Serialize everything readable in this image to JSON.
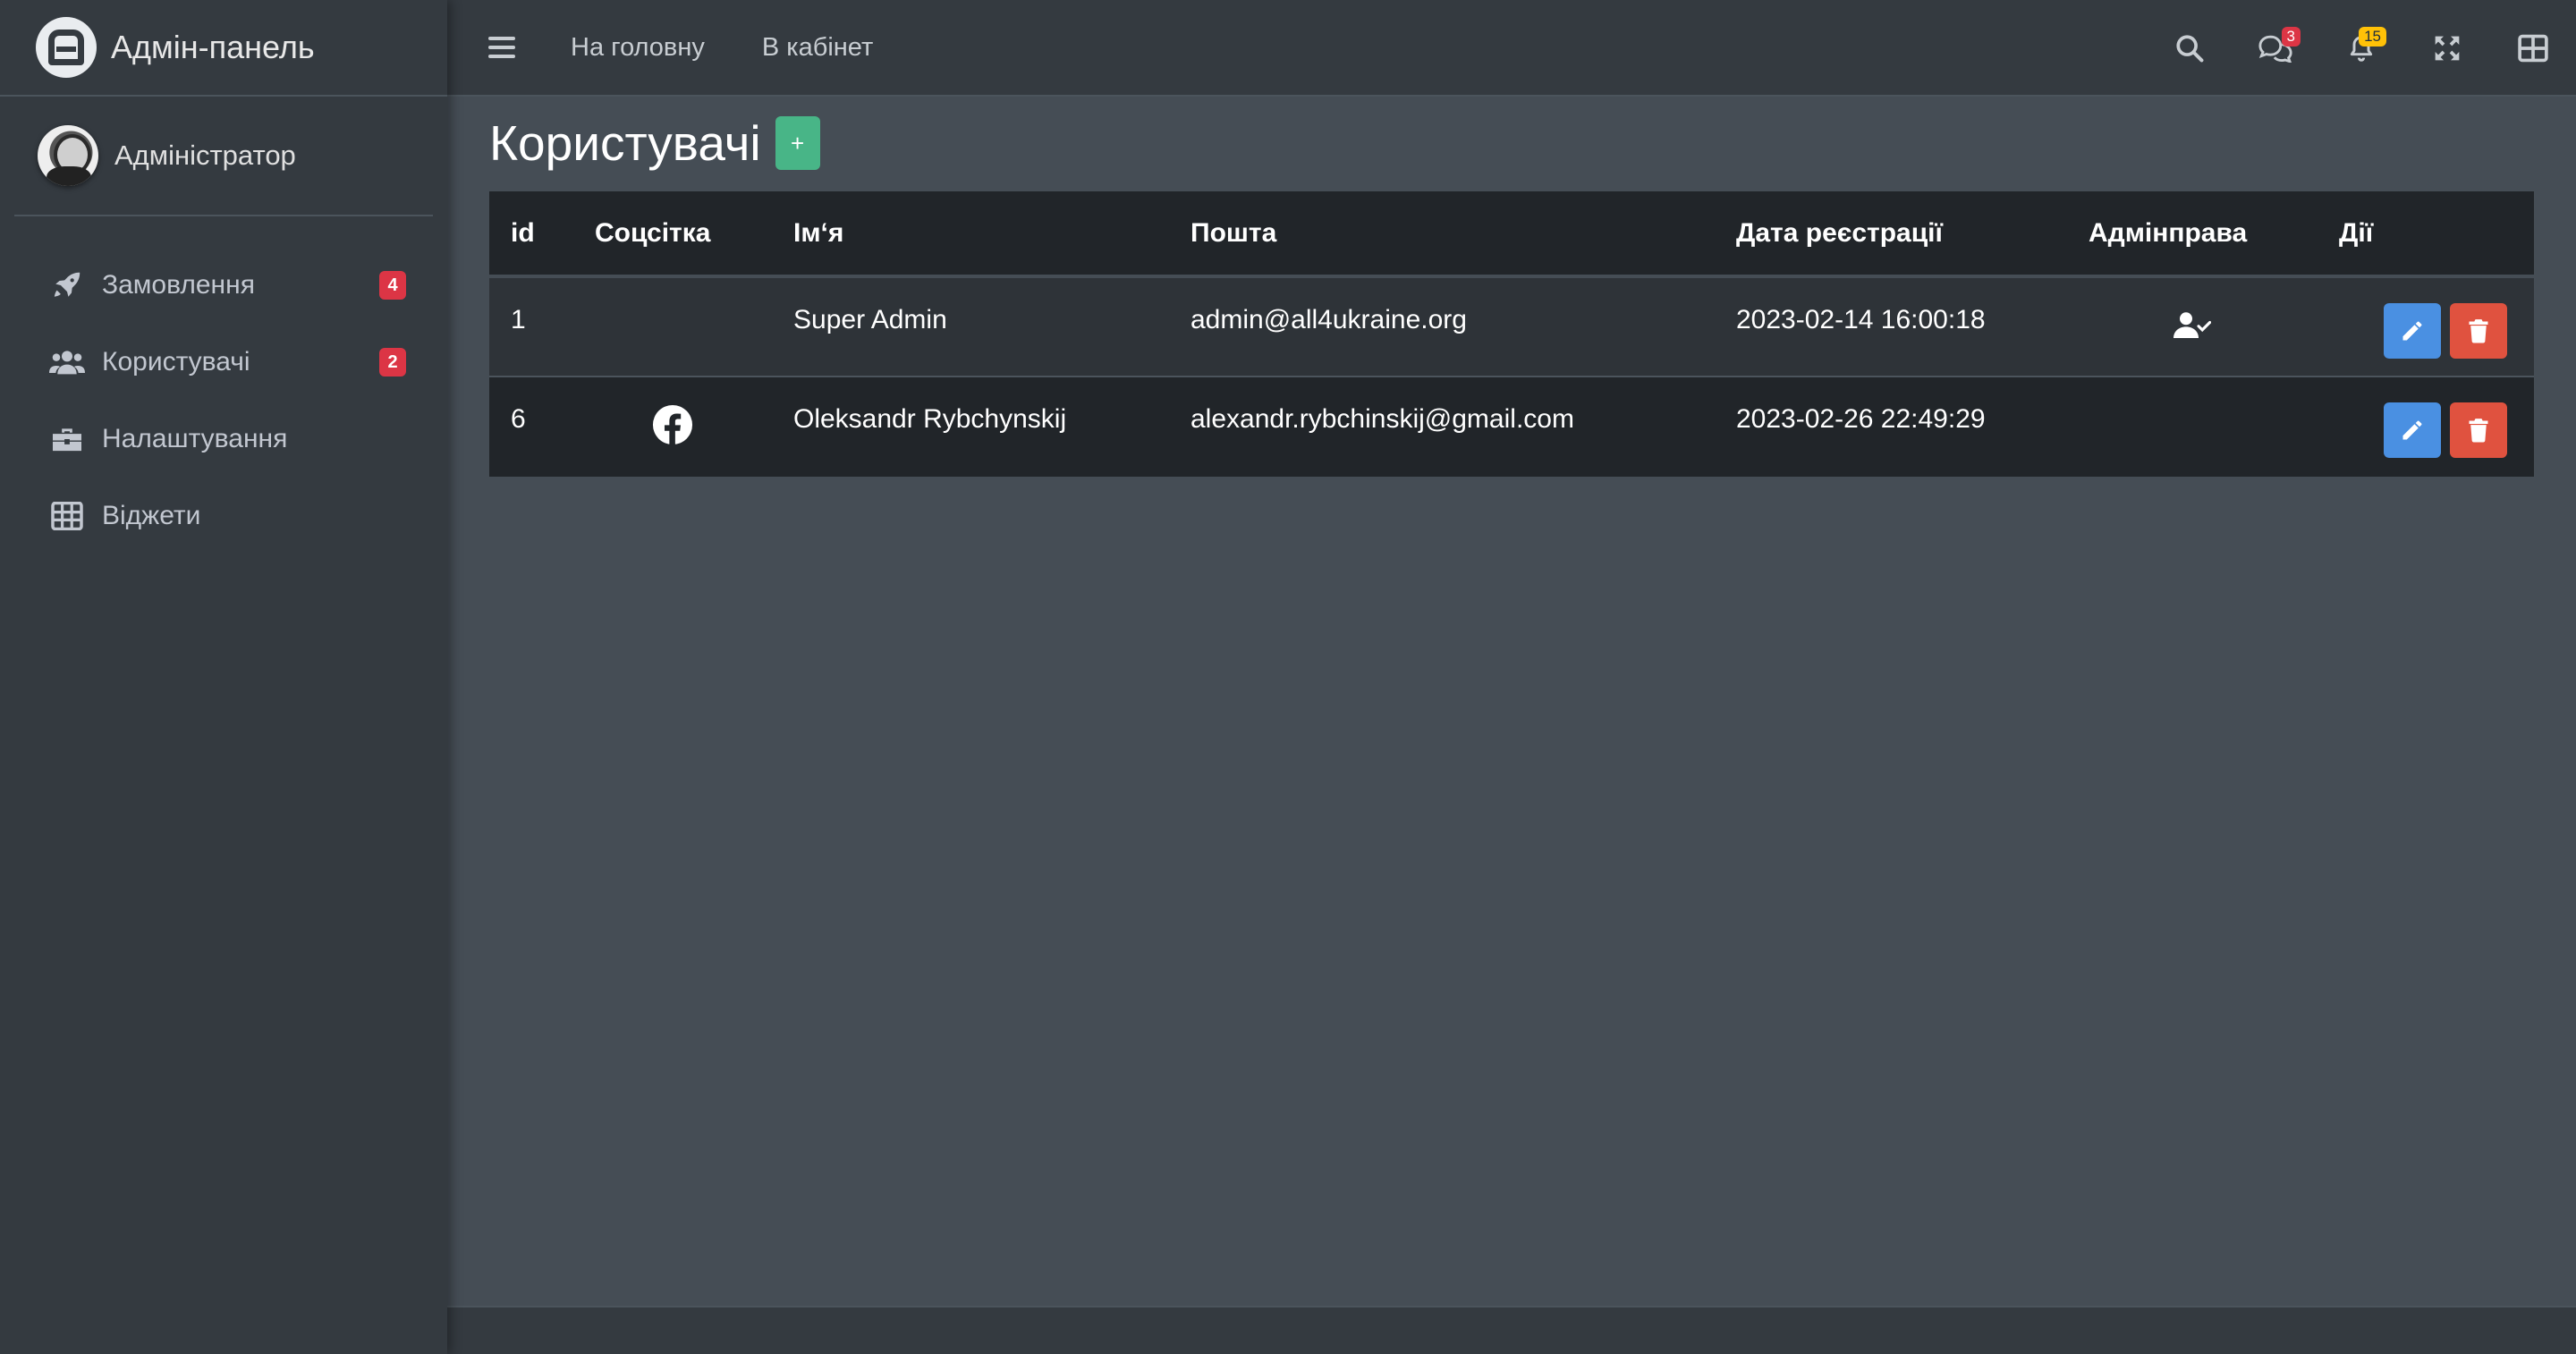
{
  "brand": {
    "title": "Адмін-панель",
    "logo_icon": "admin-logo-icon"
  },
  "user": {
    "name": "Адміністратор"
  },
  "sidebar": {
    "items": [
      {
        "label": "Замовлення",
        "icon": "rocket-icon",
        "badge": "4"
      },
      {
        "label": "Користувачі",
        "icon": "users-icon",
        "badge": "2"
      },
      {
        "label": "Налаштування",
        "icon": "toolbox-icon",
        "badge": ""
      },
      {
        "label": "Віджети",
        "icon": "grid-icon",
        "badge": ""
      }
    ]
  },
  "navbar": {
    "links": [
      "На головну",
      "В кабінет"
    ],
    "messages_count": "3",
    "notifications_count": "15"
  },
  "page": {
    "title": "Користувачі",
    "add_label": "+"
  },
  "table": {
    "headers": [
      "id",
      "Соцсітка",
      "Ім‘я",
      "Пошта",
      "Дата реєстрації",
      "Адмінправа",
      "Дії"
    ],
    "rows": [
      {
        "id": "1",
        "social": "",
        "name": "Super Admin",
        "email": "admin@all4ukraine.org",
        "registered": "2023-02-14 16:00:18",
        "is_admin": true
      },
      {
        "id": "6",
        "social": "facebook",
        "name": "Oleksandr Rybchynskij",
        "email": "alexandr.rybchinskij@gmail.com",
        "registered": "2023-02-26 22:49:29",
        "is_admin": false
      }
    ]
  },
  "colors": {
    "accent_green": "#48b587",
    "edit_blue": "#4a90e2",
    "delete_red": "#e0523f",
    "badge_red": "#dc3545",
    "badge_yellow": "#ffc107"
  }
}
